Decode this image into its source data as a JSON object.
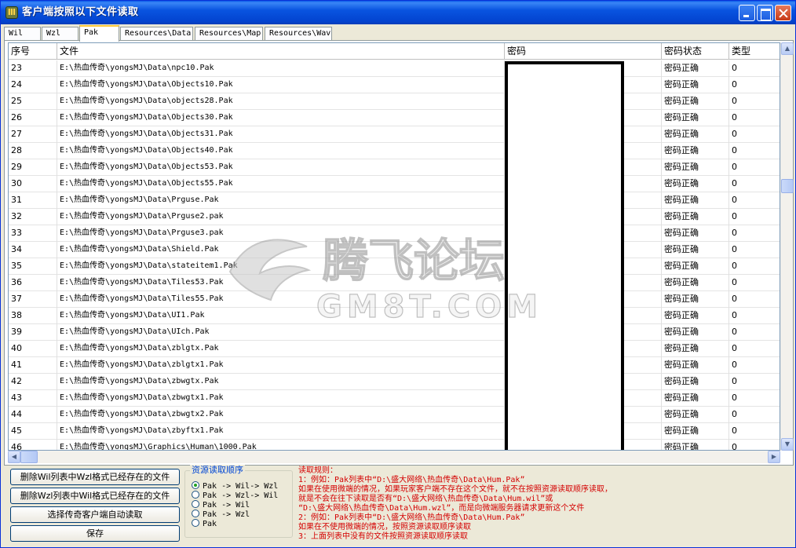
{
  "window": {
    "title": "客户端按照以下文件读取",
    "icon": "app-icon",
    "icon_glyph": "Ⅲ",
    "controls": [
      "minimize-icon",
      "maximize-icon",
      "close-icon"
    ]
  },
  "tabs": [
    {
      "label": "Wil",
      "active": false
    },
    {
      "label": "Wzl",
      "active": false
    },
    {
      "label": "Pak",
      "active": true
    },
    {
      "label": "Resources\\Data",
      "active": false
    },
    {
      "label": "Resources\\Map",
      "active": false
    },
    {
      "label": "Resources\\Wav",
      "active": false
    }
  ],
  "grid": {
    "columns": [
      "序号",
      "文件",
      "密码",
      "密码状态",
      "类型"
    ],
    "rows": [
      {
        "no": "23",
        "file": "E:\\热血传奇\\yongsMJ\\Data\\npc10.Pak",
        "status": "密码正确",
        "type": "0"
      },
      {
        "no": "24",
        "file": "E:\\热血传奇\\yongsMJ\\Data\\Objects10.Pak",
        "status": "密码正确",
        "type": "0"
      },
      {
        "no": "25",
        "file": "E:\\热血传奇\\yongsMJ\\Data\\objects28.Pak",
        "status": "密码正确",
        "type": "0"
      },
      {
        "no": "26",
        "file": "E:\\热血传奇\\yongsMJ\\Data\\Objects30.Pak",
        "status": "密码正确",
        "type": "0"
      },
      {
        "no": "27",
        "file": "E:\\热血传奇\\yongsMJ\\Data\\Objects31.Pak",
        "status": "密码正确",
        "type": "0"
      },
      {
        "no": "28",
        "file": "E:\\热血传奇\\yongsMJ\\Data\\Objects40.Pak",
        "status": "密码正确",
        "type": "0"
      },
      {
        "no": "29",
        "file": "E:\\热血传奇\\yongsMJ\\Data\\Objects53.Pak",
        "status": "密码正确",
        "type": "0"
      },
      {
        "no": "30",
        "file": "E:\\热血传奇\\yongsMJ\\Data\\Objects55.Pak",
        "status": "密码正确",
        "type": "0"
      },
      {
        "no": "31",
        "file": "E:\\热血传奇\\yongsMJ\\Data\\Prguse.Pak",
        "status": "密码正确",
        "type": "0"
      },
      {
        "no": "32",
        "file": "E:\\热血传奇\\yongsMJ\\Data\\Prguse2.pak",
        "status": "密码正确",
        "type": "0"
      },
      {
        "no": "33",
        "file": "E:\\热血传奇\\yongsMJ\\Data\\Prguse3.pak",
        "status": "密码正确",
        "type": "0"
      },
      {
        "no": "34",
        "file": "E:\\热血传奇\\yongsMJ\\Data\\Shield.Pak",
        "status": "密码正确",
        "type": "0"
      },
      {
        "no": "35",
        "file": "E:\\热血传奇\\yongsMJ\\Data\\stateitem1.Pak",
        "status": "密码正确",
        "type": "0"
      },
      {
        "no": "36",
        "file": "E:\\热血传奇\\yongsMJ\\Data\\Tiles53.Pak",
        "status": "密码正确",
        "type": "0"
      },
      {
        "no": "37",
        "file": "E:\\热血传奇\\yongsMJ\\Data\\Tiles55.Pak",
        "status": "密码正确",
        "type": "0"
      },
      {
        "no": "38",
        "file": "E:\\热血传奇\\yongsMJ\\Data\\UI1.Pak",
        "status": "密码正确",
        "type": "0"
      },
      {
        "no": "39",
        "file": "E:\\热血传奇\\yongsMJ\\Data\\UIch.Pak",
        "status": "密码正确",
        "type": "0"
      },
      {
        "no": "40",
        "file": "E:\\热血传奇\\yongsMJ\\Data\\zblgtx.Pak",
        "status": "密码正确",
        "type": "0"
      },
      {
        "no": "41",
        "file": "E:\\热血传奇\\yongsMJ\\Data\\zblgtx1.Pak",
        "status": "密码正确",
        "type": "0"
      },
      {
        "no": "42",
        "file": "E:\\热血传奇\\yongsMJ\\Data\\zbwgtx.Pak",
        "status": "密码正确",
        "type": "0"
      },
      {
        "no": "43",
        "file": "E:\\热血传奇\\yongsMJ\\Data\\zbwgtx1.Pak",
        "status": "密码正确",
        "type": "0"
      },
      {
        "no": "44",
        "file": "E:\\热血传奇\\yongsMJ\\Data\\zbwgtx2.Pak",
        "status": "密码正确",
        "type": "0"
      },
      {
        "no": "45",
        "file": "E:\\热血传奇\\yongsMJ\\Data\\zbyftx1.Pak",
        "status": "密码正确",
        "type": "0"
      },
      {
        "no": "46",
        "file": "E:\\热血传奇\\yongsMJ\\Graphics\\Human\\1000.Pak",
        "status": "密码正确",
        "type": "0"
      }
    ]
  },
  "watermark": {
    "brand": "腾飞论坛",
    "domain": "GM8T.COM"
  },
  "buttons": {
    "delete_wil": "删除Wil列表中Wzl格式已经存在的文件",
    "delete_wzl": "删除Wzl列表中Wil格式已经存在的文件",
    "auto_read": "选择传奇客户端自动读取",
    "save": "保存"
  },
  "resource_order": {
    "title": "资源读取顺序",
    "options": [
      {
        "label": "Pak -> Wil-> Wzl",
        "selected": true
      },
      {
        "label": "Pak -> Wzl-> Wil",
        "selected": false
      },
      {
        "label": "Pak -> Wil",
        "selected": false
      },
      {
        "label": "Pak -> Wzl",
        "selected": false
      },
      {
        "label": "Pak",
        "selected": false
      }
    ]
  },
  "rules": [
    "读取规则：",
    "1：例如：Pak列表中“D:\\盛大网络\\热血传奇\\Data\\Hum.Pak”",
    "   如果在使用微端的情况，如果玩家客户端不存在这个文件，就不在按照资源读取顺序读取，",
    "   就是不会在往下读取是否有“D:\\盛大网络\\热血传奇\\Data\\Hum.wil”或",
    "   “D:\\盛大网络\\热血传奇\\Data\\Hum.wzl”，而是向微端服务器请求更新这个文件",
    "2：例如：Pak列表中“D:\\盛大网络\\热血传奇\\Data\\Hum.Pak”",
    "   如果在不使用微端的情况，按照资源读取顺序读取",
    "3：上面列表中没有的文件按照资源读取顺序读取"
  ],
  "colors": {
    "titlebar": "#0954e0",
    "rules_text": "#d40000",
    "group_title": "#0046d5"
  }
}
